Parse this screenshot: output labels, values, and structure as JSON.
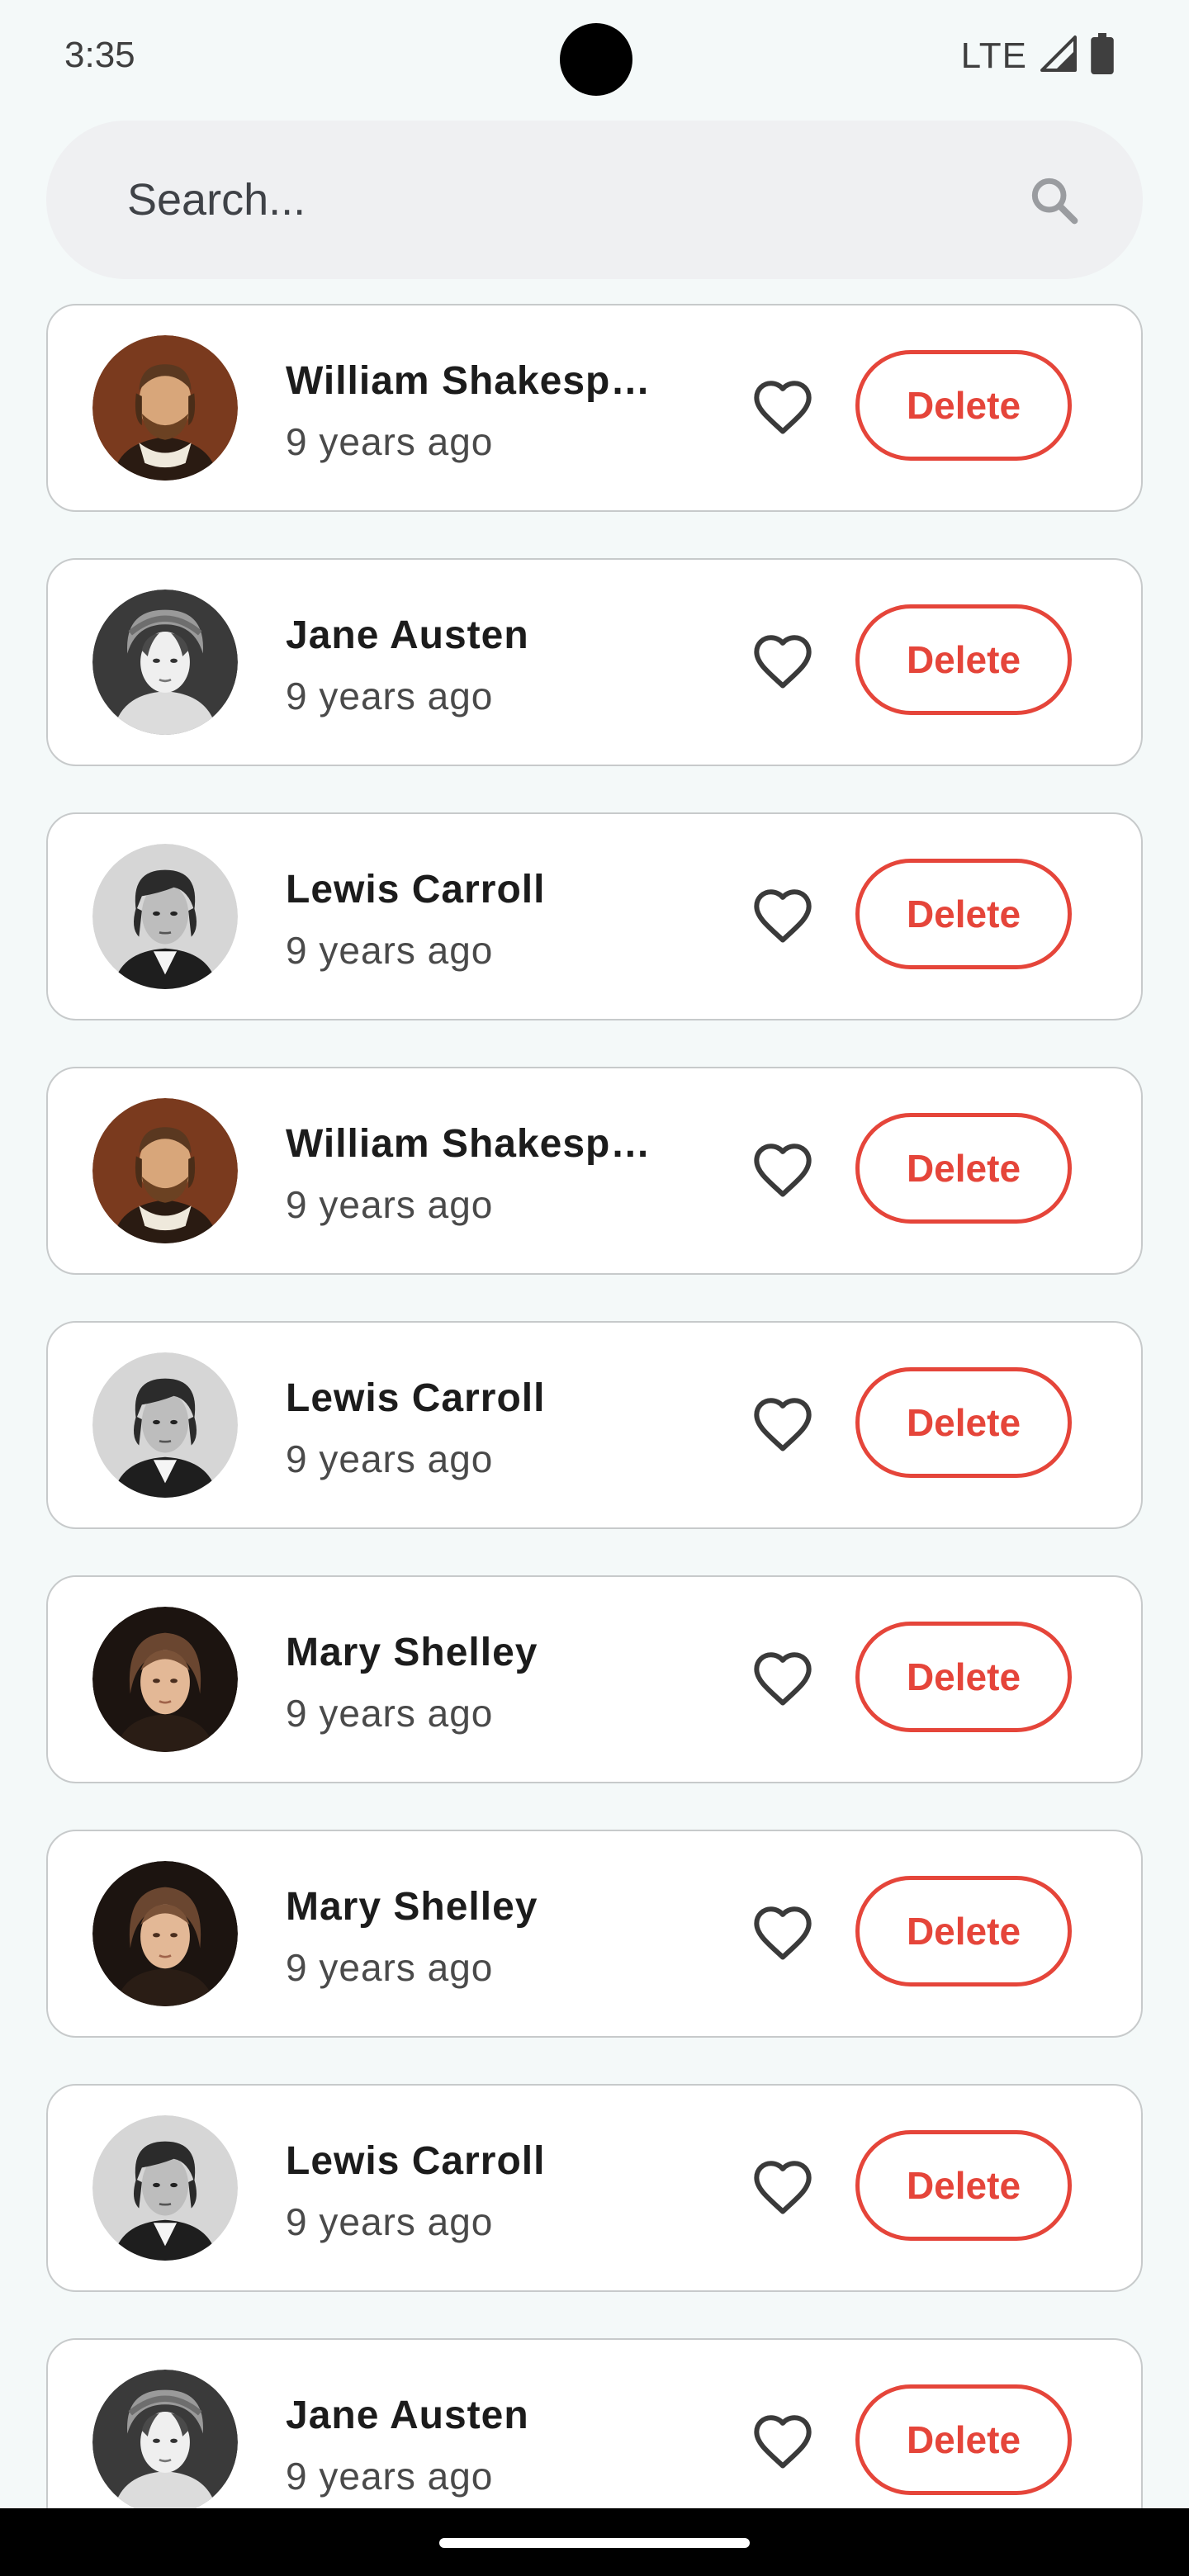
{
  "status_bar": {
    "time": "3:35",
    "network": "LTE",
    "icons": [
      "camera-cutout",
      "signal-icon",
      "battery-icon"
    ]
  },
  "search": {
    "placeholder": "Search...",
    "value": "",
    "icon": "search-icon"
  },
  "colors": {
    "background": "#f4f9f9",
    "card": "#ffffff",
    "card_border": "#c7cacb",
    "delete_accent": "#e5453a",
    "search_bg": "#eff0f2"
  },
  "authors": [
    {
      "name": "William Shakespeare",
      "display_name": "William Shakespe…",
      "time": "9 years ago",
      "avatar": "shakespeare",
      "favorited": false,
      "action": "Delete"
    },
    {
      "name": "Jane Austen",
      "display_name": "Jane Austen",
      "time": "9 years ago",
      "avatar": "austen",
      "favorited": false,
      "action": "Delete"
    },
    {
      "name": "Lewis Carroll",
      "display_name": "Lewis Carroll",
      "time": "9 years ago",
      "avatar": "carroll",
      "favorited": false,
      "action": "Delete"
    },
    {
      "name": "William Shakespeare",
      "display_name": "William Shakespe…",
      "time": "9 years ago",
      "avatar": "shakespeare",
      "favorited": false,
      "action": "Delete"
    },
    {
      "name": "Lewis Carroll",
      "display_name": "Lewis Carroll",
      "time": "9 years ago",
      "avatar": "carroll",
      "favorited": false,
      "action": "Delete"
    },
    {
      "name": "Mary Shelley",
      "display_name": "Mary Shelley",
      "time": "9 years ago",
      "avatar": "shelley",
      "favorited": false,
      "action": "Delete"
    },
    {
      "name": "Mary Shelley",
      "display_name": "Mary Shelley",
      "time": "9 years ago",
      "avatar": "shelley",
      "favorited": false,
      "action": "Delete"
    },
    {
      "name": "Lewis Carroll",
      "display_name": "Lewis Carroll",
      "time": "9 years ago",
      "avatar": "carroll",
      "favorited": false,
      "action": "Delete"
    },
    {
      "name": "Jane Austen",
      "display_name": "Jane Austen",
      "time": "9 years ago",
      "avatar": "austen",
      "favorited": false,
      "action": "Delete"
    }
  ]
}
